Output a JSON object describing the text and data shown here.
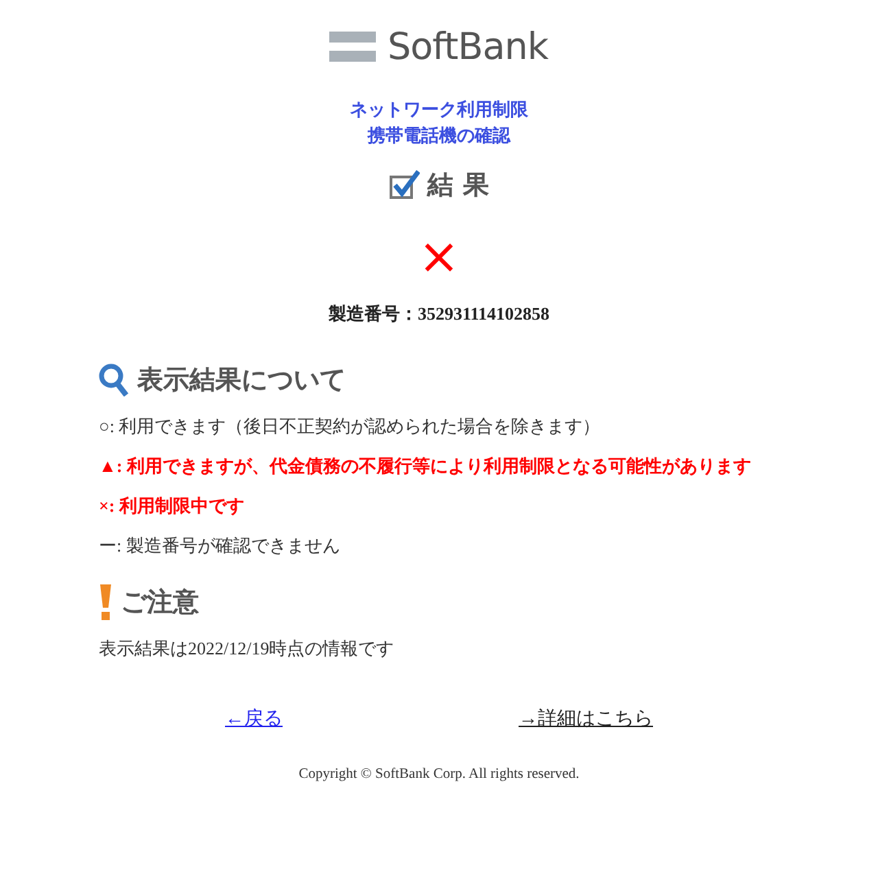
{
  "logo": {
    "text": "SoftBank"
  },
  "title_lines": [
    "ネットワーク利用制限",
    "携帯電話機の確認"
  ],
  "result": {
    "heading": {
      "kind": "result",
      "text": "結 果"
    },
    "mark": "×",
    "serial": "製造番号：352931114102858"
  },
  "legend": {
    "heading": {
      "kind": "legend",
      "text": "表示結果について"
    },
    "items": [
      {
        "text": "○: 利用できます（後日不正契約が認められた場合を除きます）",
        "color": "#333333"
      },
      {
        "text": "▲: 利用できますが、代金債務の不履行等により利用制限となる可能性があります",
        "color": "#ff0000"
      },
      {
        "text": "×: 利用制限中です",
        "color": "#ff0000"
      },
      {
        "text": "ー: 製造番号が確認できません",
        "color": "#333333"
      }
    ]
  },
  "notice": {
    "heading": {
      "kind": "caution",
      "text": "ご注意"
    },
    "text": "表示結果は2022/12/19時点の情報です"
  },
  "links": [
    {
      "text": "←戻る",
      "visited": false
    },
    {
      "text": "→詳細はこちら",
      "visited": true
    }
  ],
  "copyright": "Copyright © SoftBank Corp. All rights reserved."
}
